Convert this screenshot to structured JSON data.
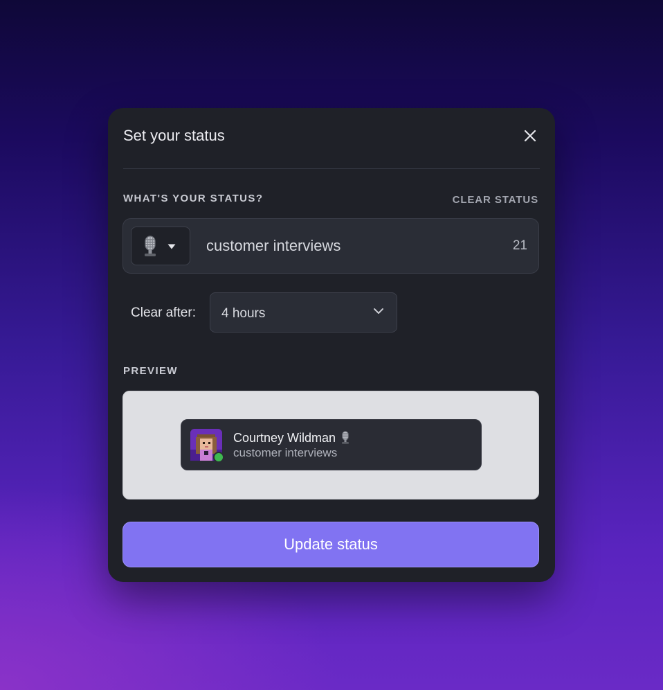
{
  "dialog": {
    "title": "Set your status",
    "close_icon": "close-icon"
  },
  "status_section": {
    "label": "WHAT'S YOUR STATUS?",
    "clear_label": "CLEAR STATUS",
    "emoji_icon": "microphone-icon",
    "text": "customer interviews",
    "char_count": "21"
  },
  "clear_after": {
    "label": "Clear after:",
    "selected": "4 hours"
  },
  "preview": {
    "label": "PREVIEW",
    "name": "Courtney Wildman",
    "status_text": "customer interviews",
    "presence": "online",
    "presence_color": "#3fb950"
  },
  "actions": {
    "update_label": "Update status",
    "accent_color": "#8173f2"
  }
}
